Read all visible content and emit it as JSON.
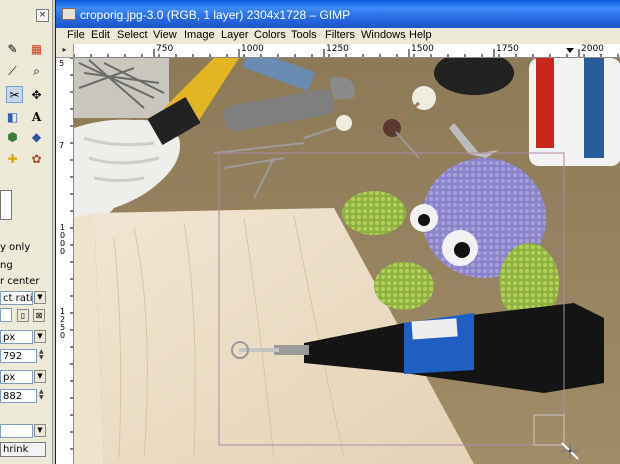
{
  "window": {
    "title": "croporig.jpg-3.0 (RGB, 1 layer) 2304x1728 – GIMP"
  },
  "menu": [
    "File",
    "Edit",
    "Select",
    "View",
    "Image",
    "Layer",
    "Colors",
    "Tools",
    "Filters",
    "Windows",
    "Help"
  ],
  "hruler_ticks": [
    "750",
    "1000",
    "1250",
    "1500",
    "1750",
    "2000"
  ],
  "vruler_ticks": [
    "5",
    "7",
    "1000",
    "1250"
  ],
  "tool_options": {
    "only": "y only",
    "ng": "ng",
    "center": "r center",
    "aspect": "ct ratio",
    "unit1": "px",
    "width_value": "792",
    "unit2": "px",
    "height_value": "882",
    "shrink": "hrink"
  },
  "colors": {
    "title_bar": "#2566e0",
    "selection_rect": "#b08aa8"
  },
  "icons": [
    "close-icon",
    "gimp-image-icon",
    "crop-tool-icon"
  ]
}
